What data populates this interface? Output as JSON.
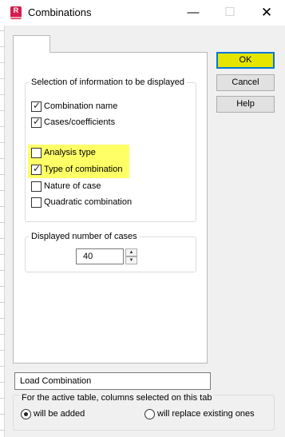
{
  "window": {
    "title": "Combinations",
    "app_icon_letter": "R"
  },
  "tab": {
    "label": ""
  },
  "selection_group": {
    "title": "Selection of information to be displayed",
    "items": [
      {
        "label": "Combination name",
        "checked": true,
        "highlighted": false
      },
      {
        "label": "Cases/coefficients",
        "checked": true,
        "highlighted": false
      },
      {
        "label": "Analysis type",
        "checked": false,
        "highlighted": true
      },
      {
        "label": "Type of combination",
        "checked": true,
        "highlighted": true
      },
      {
        "label": "Nature of case",
        "checked": false,
        "highlighted": false
      },
      {
        "label": "Quadratic combination",
        "checked": false,
        "highlighted": false
      }
    ]
  },
  "cases_group": {
    "title": "Displayed number of cases",
    "value": "40"
  },
  "buttons": {
    "ok": "OK",
    "cancel": "Cancel",
    "help": "Help"
  },
  "name_field": {
    "value": "Load Combination"
  },
  "columns_group": {
    "title": "For the active table, columns selected on this tab",
    "options": [
      {
        "label": "will be added",
        "selected": true
      },
      {
        "label": "will replace existing ones",
        "selected": false
      }
    ]
  },
  "colors": {
    "highlight": "#ffff66",
    "ok_fill": "#e5e500",
    "focus_border": "#0078d7",
    "app_icon": "#d61c4e"
  },
  "icons": {
    "checkbox_tick": "✓",
    "spin_up": "▲",
    "spin_down": "▼",
    "minimize": "—",
    "maximize": "☐",
    "close": "✕"
  }
}
